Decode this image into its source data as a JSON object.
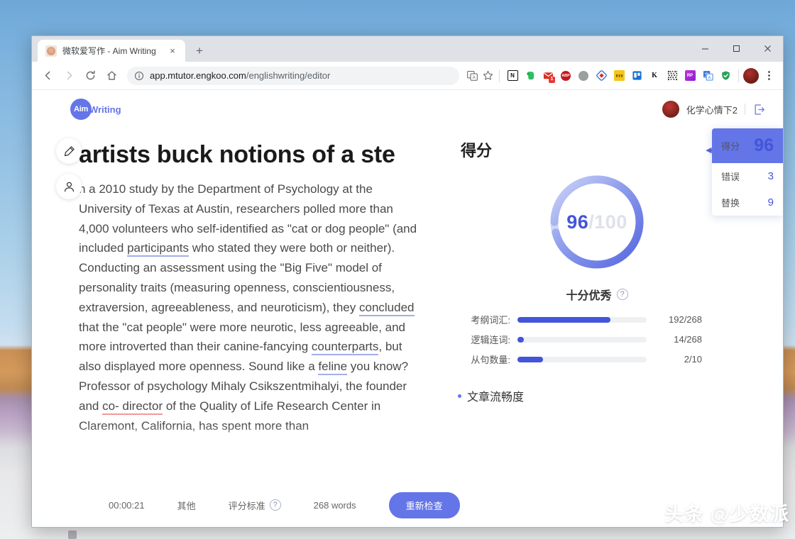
{
  "browser": {
    "tab": {
      "title": "微软爱写作 - Aim Writing",
      "favicon_name": "aim-writing-favicon",
      "close_label": "×"
    },
    "new_tab_label": "+",
    "window_controls": {
      "minimize": "–",
      "maximize": "□",
      "close": "✕"
    },
    "nav": {
      "back": "←",
      "forward": "→",
      "reload": "↻",
      "home": "⌂"
    },
    "omnibox": {
      "url_prefix": "app.mtutor.engkoo.com",
      "url_path": "/englishwriting/editor",
      "info_icon": "ⓘ"
    },
    "omni_actions": [
      {
        "name": "translate-icon",
        "glyph": "文"
      },
      {
        "name": "bookmark-star-icon",
        "glyph": "☆"
      }
    ],
    "extensions": [
      {
        "name": "notion-extension",
        "label": "N",
        "bg": "#ffffff",
        "fg": "#111111",
        "shape": "square-outline"
      },
      {
        "name": "evernote-extension",
        "label": "",
        "bg": "#2dbe60",
        "fg": "#ffffff",
        "shape": "elephant"
      },
      {
        "name": "gmail-checker-extension",
        "label": "M",
        "bg": "#d93025",
        "fg": "#ffffff",
        "shape": "square",
        "badge": "1"
      },
      {
        "name": "adblock-plus-extension",
        "label": "ABP",
        "bg": "#c4171e",
        "fg": "#ffffff",
        "shape": "circle"
      },
      {
        "name": "grammarly-extension",
        "label": "",
        "bg": "#9aa09d",
        "fg": "#ffffff",
        "shape": "circle"
      },
      {
        "name": "diigo-extension",
        "label": "◇",
        "bg": "#2f6fe0",
        "fg": "#ffffff",
        "shape": "diamond"
      },
      {
        "name": "sticky-notes-extension",
        "label": "",
        "bg": "#f5c518",
        "fg": "#333333",
        "shape": "square"
      },
      {
        "name": "trello-extension",
        "label": "",
        "bg": "#1a6fd4",
        "fg": "#ffffff",
        "shape": "square"
      },
      {
        "name": "kami-extension",
        "label": "K",
        "bg": "#ffffff",
        "fg": "#111111",
        "shape": "text"
      },
      {
        "name": "qr-code-extension",
        "label": "",
        "bg": "#333333",
        "fg": "#ffffff",
        "shape": "qr"
      },
      {
        "name": "readwise-extension",
        "label": "RP",
        "bg": "#c034d8",
        "fg": "#ffffff",
        "shape": "square"
      },
      {
        "name": "google-translate-extension",
        "label": "文",
        "bg": "#3b7ddd",
        "fg": "#ffffff",
        "shape": "square"
      },
      {
        "name": "shield-security-extension",
        "label": "",
        "bg": "#2aa05a",
        "fg": "#ffffff",
        "shape": "shield"
      }
    ],
    "profile_name": "profile-avatar",
    "menu_name": "chrome-menu"
  },
  "app": {
    "logo": {
      "badge": "Aim",
      "word": "Writing"
    },
    "user": {
      "name": "化学心情下2",
      "logout_name": "logout-icon"
    },
    "float_tools": [
      {
        "name": "edit-pencil-tool",
        "icon": "pencil"
      },
      {
        "name": "user-profile-tool",
        "icon": "person"
      }
    ],
    "document": {
      "title": "artists buck notions of a ste",
      "paragraph_parts": [
        {
          "t": "n a 2010 study by the Department of Psychology at the University of Texas at Austin, researchers polled more than 4,000 volunteers who self-identified as \"cat or dog people\" (and included ",
          "mark": "none"
        },
        {
          "t": "participants",
          "mark": "suggestion"
        },
        {
          "t": " who stated they were both or neither). Conducting an assessment using the \"Big Five\" model of personality traits (measuring openness, conscientiousness, extraversion, agreeableness, and neuroticism), they ",
          "mark": "none"
        },
        {
          "t": "concluded",
          "mark": "suggestion"
        },
        {
          "t": " that the \"cat people\" were more neurotic, less agreeable, and more introverted than their canine-fancying ",
          "mark": "none"
        },
        {
          "t": "counterparts",
          "mark": "suggestion"
        },
        {
          "t": ", but also displayed more openness. Sound like a ",
          "mark": "none"
        },
        {
          "t": "feline",
          "mark": "suggestion"
        },
        {
          "t": " you know? Professor of psychology Mihaly Csikszentmihalyi, the founder and ",
          "mark": "none"
        },
        {
          "t": "co- director",
          "mark": "error"
        },
        {
          "t": " of the Quality of Life Research Center in Claremont, California, has spent more than",
          "mark": "none"
        }
      ]
    },
    "score_panel": {
      "heading": "得分",
      "collapse_icon": "◀◀",
      "gauge": {
        "score": "96",
        "separator": "/",
        "total": "100",
        "percent": 96
      },
      "rating": {
        "text": "十分优秀",
        "help": "?"
      },
      "metrics": [
        {
          "label": "考纲词汇:",
          "value": "192/268",
          "percent": 72
        },
        {
          "label": "逻辑连词:",
          "value": "14/268",
          "percent": 5
        },
        {
          "label": "从句数量:",
          "value": "2/10",
          "percent": 20
        }
      ],
      "fluency": "文章流畅度"
    },
    "score_card": [
      {
        "key": "得分",
        "value": "96",
        "highlight": true
      },
      {
        "key": "错误",
        "value": "3",
        "highlight": false
      },
      {
        "key": "替换",
        "value": "9",
        "highlight": false
      }
    ],
    "bottom_bar": {
      "timer": "00:00:21",
      "category": "其他",
      "criteria": "评分标准",
      "criteria_help": "?",
      "word_count": "268 words",
      "recheck": "重新检查"
    }
  },
  "watermark": "头条 @少数派",
  "colors": {
    "accent": "#6475e8",
    "accent_dark": "#4355d9",
    "suggestion_underline": "#a3aee8",
    "error_underline": "#ef9a9a"
  }
}
